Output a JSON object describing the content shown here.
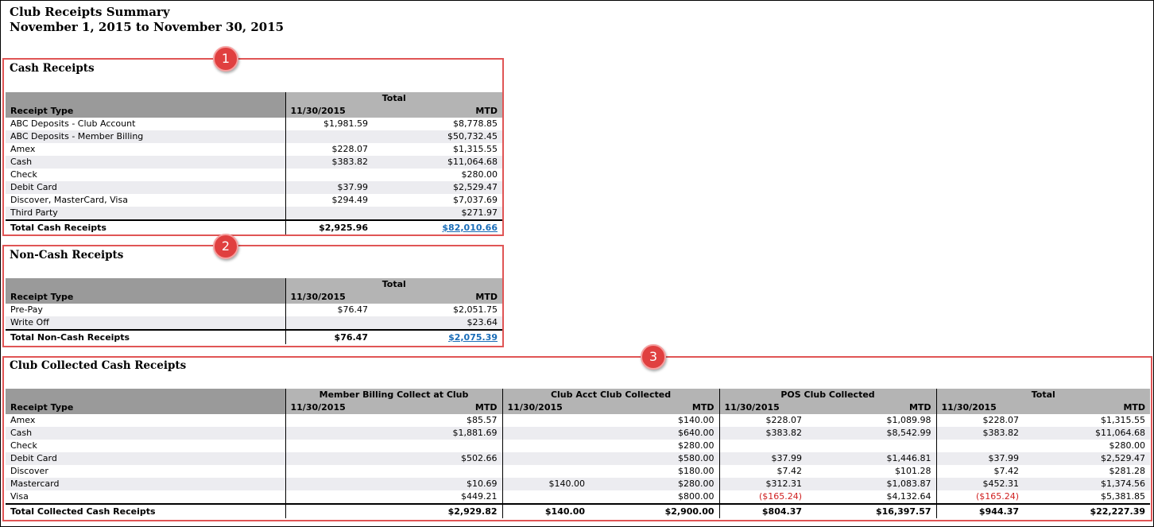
{
  "header": {
    "title": "Club Receipts Summary",
    "subtitle": "November 1, 2015 to November 30, 2015"
  },
  "badges": [
    "1",
    "2",
    "3"
  ],
  "cash": {
    "title": "Cash Receipts",
    "group": "Total",
    "col_type": "Receipt Type",
    "col_date": "11/30/2015",
    "col_mtd": "MTD",
    "rows": [
      [
        "ABC Deposits - Club Account",
        "$1,981.59",
        "$8,778.85"
      ],
      [
        "ABC Deposits - Member Billing",
        "",
        "$50,732.45"
      ],
      [
        "Amex",
        "$228.07",
        "$1,315.55"
      ],
      [
        "Cash",
        "$383.82",
        "$11,064.68"
      ],
      [
        "Check",
        "",
        "$280.00"
      ],
      [
        "Debit Card",
        "$37.99",
        "$2,529.47"
      ],
      [
        "Discover, MasterCard, Visa",
        "$294.49",
        "$7,037.69"
      ],
      [
        "Third Party",
        "",
        "$271.97"
      ]
    ],
    "total": [
      "Total Cash Receipts",
      "$2,925.96",
      "$82,010.66"
    ]
  },
  "noncash": {
    "title": "Non-Cash Receipts",
    "group": "Total",
    "col_type": "Receipt Type",
    "col_date": "11/30/2015",
    "col_mtd": "MTD",
    "rows": [
      [
        "Pre-Pay",
        "$76.47",
        "$2,051.75"
      ],
      [
        "Write Off",
        "",
        "$23.64"
      ]
    ],
    "total": [
      "Total Non-Cash Receipts",
      "$76.47",
      "$2,075.39"
    ]
  },
  "club": {
    "title": "Club Collected Cash Receipts",
    "groups": [
      "Member Billing Collect at Club",
      "Club Acct Club Collected",
      "POS Club Collected",
      "Total"
    ],
    "col_type": "Receipt Type",
    "col_date": "11/30/2015",
    "col_mtd": "MTD",
    "rows": [
      [
        "Amex",
        "",
        "$85.57",
        "",
        "$140.00",
        "$228.07",
        "$1,089.98",
        "$228.07",
        "$1,315.55"
      ],
      [
        "Cash",
        "",
        "$1,881.69",
        "",
        "$640.00",
        "$383.82",
        "$8,542.99",
        "$383.82",
        "$11,064.68"
      ],
      [
        "Check",
        "",
        "",
        "",
        "$280.00",
        "",
        "",
        "",
        "$280.00"
      ],
      [
        "Debit Card",
        "",
        "$502.66",
        "",
        "$580.00",
        "$37.99",
        "$1,446.81",
        "$37.99",
        "$2,529.47"
      ],
      [
        "Discover",
        "",
        "",
        "",
        "$180.00",
        "$7.42",
        "$101.28",
        "$7.42",
        "$281.28"
      ],
      [
        "Mastercard",
        "",
        "$10.69",
        "$140.00",
        "$280.00",
        "$312.31",
        "$1,083.87",
        "$452.31",
        "$1,374.56"
      ],
      [
        "Visa",
        "",
        "$449.21",
        "",
        "$800.00",
        "($165.24)",
        "$4,132.64",
        "($165.24)",
        "$5,381.85"
      ]
    ],
    "total": [
      "Total Collected Cash Receipts",
      "",
      "$2,929.82",
      "$140.00",
      "$2,900.00",
      "$804.37",
      "$16,397.57",
      "$944.37",
      "$22,227.39"
    ]
  }
}
